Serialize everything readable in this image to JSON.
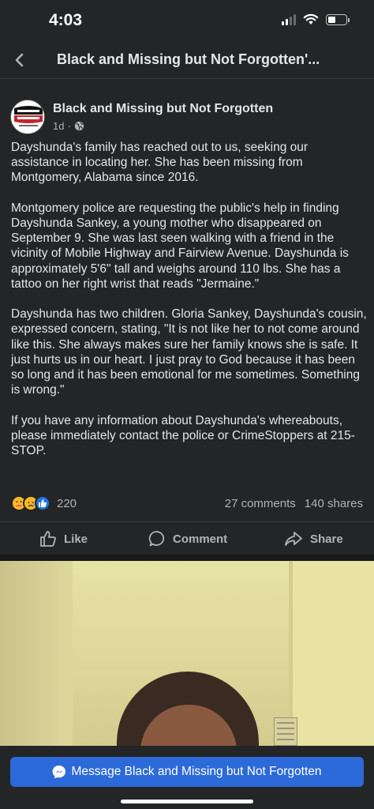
{
  "status_bar": {
    "time": "4:03",
    "battery_level": 0.45
  },
  "nav": {
    "title": "Black and Missing but Not Forgotten'...",
    "back_icon": "chevron-left-icon"
  },
  "post": {
    "author": "Black and Missing but Not Forgotten",
    "avatar_logo_text": "BLACK MISSING",
    "time_ago": "1d",
    "separator": "·",
    "audience_icon": "globe-icon",
    "paragraphs": [
      "Dayshunda's family has reached out to us, seeking our assistance in locating her. She has been missing from Montgomery, Alabama since 2016.",
      "Montgomery police are requesting the public's help in finding Dayshunda Sankey, a young mother who disappeared on September 9. She was last seen walking with a friend in the vicinity of Mobile Highway and Fairview Avenue. Dayshunda is approximately 5'6\" tall and weighs around 110 lbs. She has a tattoo on her right wrist that reads \"Jermaine.\"",
      "Dayshunda has two children. Gloria Sankey, Dayshunda's cousin, expressed concern, stating, \"It is not like her to not come around like this. She always makes sure her family knows she is safe. It just hurts us in our heart. I just pray to God because it has been so long and it has been emotional for me sometimes. Something is wrong.\"",
      "If you have any information about Dayshunda's whereabouts, please immediately contact the police or CrimeStoppers at 215-STOP."
    ],
    "reactions": {
      "icons": [
        "care-icon",
        "sad-icon",
        "like-icon"
      ],
      "count": "220",
      "comments": "27 comments",
      "shares": "140 shares"
    },
    "actions": {
      "like": "Like",
      "comment": "Comment",
      "share": "Share"
    }
  },
  "message_button": {
    "label": "Message Black and Missing but Not Forgotten",
    "icon": "messenger-icon"
  },
  "colors": {
    "background": "#242526",
    "text": "#e4e6eb",
    "secondary_text": "#b0b3b8",
    "button_blue": "#2d6ad9"
  }
}
